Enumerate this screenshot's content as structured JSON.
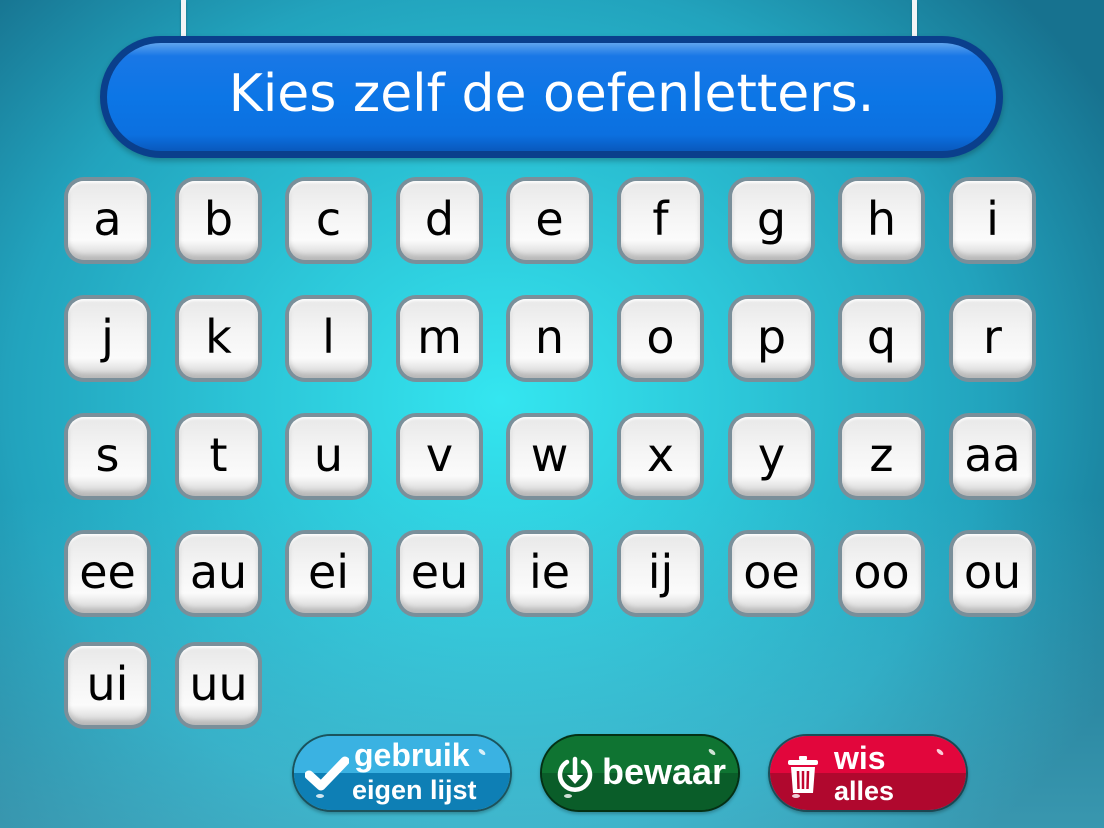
{
  "header": {
    "title": "Kies zelf de oefenletters."
  },
  "letters": [
    "a",
    "b",
    "c",
    "d",
    "e",
    "f",
    "g",
    "h",
    "i",
    "j",
    "k",
    "l",
    "m",
    "n",
    "o",
    "p",
    "q",
    "r",
    "s",
    "t",
    "u",
    "v",
    "w",
    "x",
    "y",
    "z",
    "aa",
    "ee",
    "au",
    "ei",
    "eu",
    "ie",
    "ij",
    "oe",
    "oo",
    "ou",
    "ui",
    "uu"
  ],
  "buttons": {
    "use_own_list": {
      "line1": "gebruik",
      "line2": "eigen lijst",
      "icon": "checkmark-icon",
      "color": "#1a93cc"
    },
    "save": {
      "label": "bewaar",
      "icon": "download-circle-icon",
      "color": "#0a6a2e"
    },
    "clear_all": {
      "line1": "wis",
      "line2": "alles",
      "icon": "trash-icon",
      "color": "#d4063a"
    }
  },
  "colors": {
    "title_bar": "#0c76e6",
    "title_border": "#0a3f8c",
    "tile_border": "#7a8f9a",
    "background_center": "#34e6f0",
    "background_edge": "#17728f"
  }
}
